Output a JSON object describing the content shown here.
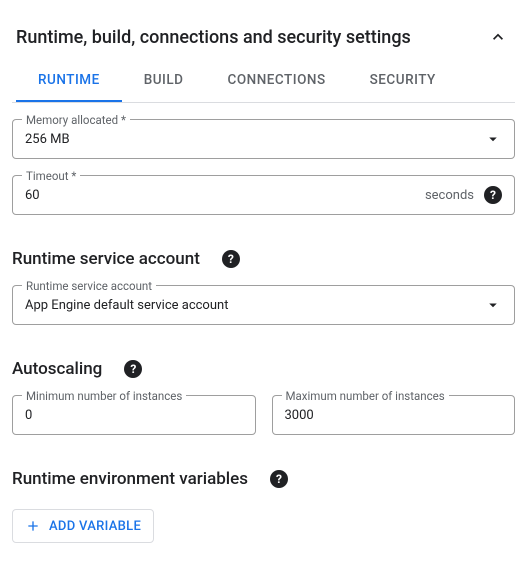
{
  "colors": {
    "accent": "#1a73e8",
    "text": "#202124",
    "muted": "#5f6368",
    "border": "#dadce0"
  },
  "header": {
    "title": "Runtime, build, connections and security settings"
  },
  "tabs": {
    "t0": "RUNTIME",
    "t1": "BUILD",
    "t2": "CONNECTIONS",
    "t3": "SECURITY",
    "active_index": 0
  },
  "memory": {
    "label": "Memory allocated *",
    "value": "256 MB"
  },
  "timeout": {
    "label": "Timeout *",
    "value": "60",
    "unit": "seconds"
  },
  "service_account": {
    "section_title": "Runtime service account",
    "label": "Runtime service account",
    "value": "App Engine default service account"
  },
  "autoscaling": {
    "section_title": "Autoscaling",
    "min_label": "Minimum number of instances",
    "min_value": "0",
    "max_label": "Maximum number of instances",
    "max_value": "3000"
  },
  "env": {
    "section_title": "Runtime environment variables",
    "add_button": "ADD VARIABLE"
  }
}
